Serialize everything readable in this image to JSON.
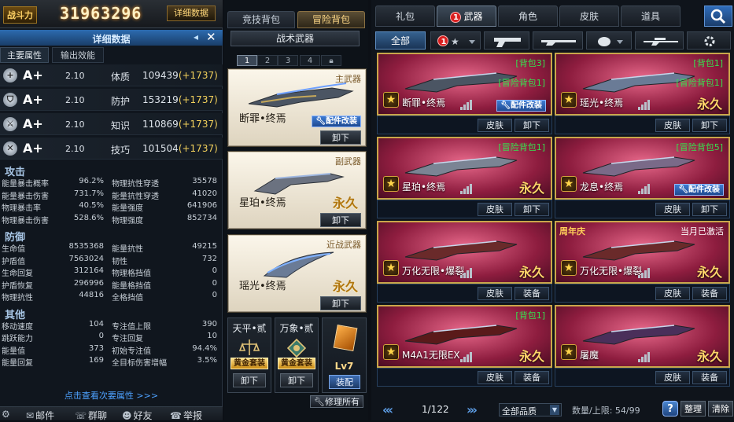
{
  "header": {
    "power_label": "战斗力",
    "power_value": "31963296",
    "details_button": "详细数据"
  },
  "details_panel": {
    "title": "详细数据",
    "tabs": [
      "主要属性",
      "输出效能"
    ],
    "attributes": [
      {
        "icon": "plus-icon",
        "grade": "A+",
        "value": "2.10",
        "name": "体质",
        "amount": "109439",
        "bonus": "(+1737)"
      },
      {
        "icon": "shield-icon",
        "grade": "A+",
        "value": "2.10",
        "name": "防护",
        "amount": "153219",
        "bonus": "(+1737)"
      },
      {
        "icon": "swords-icon",
        "grade": "A+",
        "value": "2.10",
        "name": "知识",
        "amount": "110869",
        "bonus": "(+1737)"
      },
      {
        "icon": "blade-icon",
        "grade": "A+",
        "value": "2.10",
        "name": "技巧",
        "amount": "101504",
        "bonus": "(+1737)"
      }
    ],
    "sections": [
      {
        "title": "攻击",
        "rows": [
          [
            "能量暴击概率",
            "96.2%",
            "物理抗性穿透",
            "35578"
          ],
          [
            "能量暴击伤害",
            "731.7%",
            "能量抗性穿透",
            "41020"
          ],
          [
            "物理暴击率",
            "40.5%",
            "能量强度",
            "641906"
          ],
          [
            "物理暴击伤害",
            "528.6%",
            "物理强度",
            "852734"
          ]
        ]
      },
      {
        "title": "防御",
        "rows": [
          [
            "生命值",
            "8535368",
            "能量抗性",
            "49215"
          ],
          [
            "护盾值",
            "7563024",
            "韧性",
            "732"
          ],
          [
            "生命回复",
            "312164",
            "物理格挡值",
            "0"
          ],
          [
            "护盾恢复",
            "296996",
            "能量格挡值",
            "0"
          ],
          [
            "物理抗性",
            "44816",
            "全格挡值",
            "0"
          ]
        ]
      },
      {
        "title": "其他",
        "rows": [
          [
            "移动速度",
            "104",
            "专注值上限",
            "390"
          ],
          [
            "跳跃能力",
            "0",
            "专注回复",
            "10"
          ],
          [
            "能量值",
            "373",
            "初始专注值",
            "94.4%"
          ],
          [
            "能量回复",
            "169",
            "全目标伤害增幅",
            "3.5%"
          ]
        ]
      }
    ],
    "view_more": "点击查看次要属性 >>>",
    "footer": [
      {
        "icon": "gear-icon",
        "label": ""
      },
      {
        "icon": "mail-icon",
        "label": "邮件"
      },
      {
        "icon": "chat-icon",
        "label": "群聊"
      },
      {
        "icon": "friends-icon",
        "label": "好友"
      },
      {
        "icon": "report-icon",
        "label": "举报"
      }
    ]
  },
  "loadout": {
    "tabs": [
      "竞技背包",
      "冒险背包"
    ],
    "tactical_title": "战术武器",
    "pages": [
      "1",
      "2",
      "3",
      "4"
    ],
    "slots": [
      {
        "type": "主武器",
        "name": "断罪•终焉",
        "badge": "配件改装",
        "action": "卸下",
        "permanent": ""
      },
      {
        "type": "副武器",
        "name": "星珀•终焉",
        "badge": "",
        "action": "卸下",
        "permanent": "永久"
      },
      {
        "type": "近战武器",
        "name": "瑶光•终焉",
        "badge": "",
        "action": "卸下",
        "permanent": "永久"
      }
    ],
    "minis": [
      {
        "title": "天平•贰",
        "gold": "黄金套装",
        "action": "卸下"
      },
      {
        "title": "万象•贰",
        "gold": "黄金套装",
        "action": "卸下"
      }
    ],
    "level_item": {
      "level": "Lv7",
      "action": "装配"
    },
    "repair_all": "修理所有"
  },
  "inventory": {
    "tabs": [
      {
        "label": "礼包",
        "badge": ""
      },
      {
        "label": "武器",
        "badge": "1"
      },
      {
        "label": "角色",
        "badge": ""
      },
      {
        "label": "皮肤",
        "badge": ""
      },
      {
        "label": "道具",
        "badge": ""
      }
    ],
    "filters": [
      {
        "label": "全部",
        "icon": "",
        "badge": ""
      },
      {
        "label": "",
        "icon": "star-icon",
        "badge": "1"
      },
      {
        "label": "",
        "icon": "pistol-icon",
        "badge": ""
      },
      {
        "label": "",
        "icon": "rifle-icon",
        "badge": ""
      },
      {
        "label": "",
        "icon": "grenade-icon",
        "badge": ""
      },
      {
        "label": "",
        "icon": "sniper-icon",
        "badge": ""
      },
      {
        "label": "",
        "icon": "gear-icon",
        "badge": ""
      }
    ],
    "items": [
      {
        "name": "断罪•终焉",
        "tag": "[背包3]",
        "tag2": "[冒险背包1]",
        "badge": "配件改装",
        "permanent": "",
        "top_left": "",
        "top_right": "",
        "buttons": [
          "皮肤",
          "卸下"
        ]
      },
      {
        "name": "瑶光•终焉",
        "tag": "[背包1]",
        "tag2": "[冒险背包1]",
        "badge": "",
        "permanent": "永久",
        "top_left": "",
        "top_right": "",
        "buttons": [
          "皮肤",
          "卸下"
        ]
      },
      {
        "name": "星珀•终焉",
        "tag": "[冒险背包1]",
        "tag2": "",
        "badge": "",
        "permanent": "永久",
        "top_left": "",
        "top_right": "",
        "buttons": [
          "皮肤",
          "卸下"
        ]
      },
      {
        "name": "龙息•终焉",
        "tag": "[冒险背包5]",
        "tag2": "",
        "badge": "配件改装",
        "permanent": "",
        "top_left": "",
        "top_right": "",
        "buttons": [
          "皮肤",
          "卸下"
        ]
      },
      {
        "name": "万化无限•爆裂",
        "tag": "",
        "tag2": "",
        "badge": "",
        "permanent": "永久",
        "top_left": "",
        "top_right": "",
        "buttons": [
          "皮肤",
          "装备"
        ]
      },
      {
        "name": "万化无限•爆裂",
        "tag": "",
        "tag2": "",
        "badge": "",
        "permanent": "永久",
        "top_left": "周年庆",
        "top_right": "当月已激活",
        "buttons": [
          "皮肤",
          "装备"
        ]
      },
      {
        "name": "M4A1无限EX",
        "tag": "[背包1]",
        "tag2": "",
        "badge": "",
        "permanent": "永久",
        "top_left": "",
        "top_right": "",
        "buttons": [
          "皮肤",
          "装备"
        ]
      },
      {
        "name": "屠魔",
        "tag": "",
        "tag2": "",
        "badge": "",
        "permanent": "永久",
        "top_left": "",
        "top_right": "",
        "buttons": [
          "皮肤",
          "装备"
        ]
      }
    ],
    "pager": {
      "current": "1/122",
      "quality": "全部品质",
      "capacity": "数量/上限: 54/99"
    },
    "buttons": {
      "help": "?",
      "sort": "整理",
      "clear": "清除"
    }
  }
}
